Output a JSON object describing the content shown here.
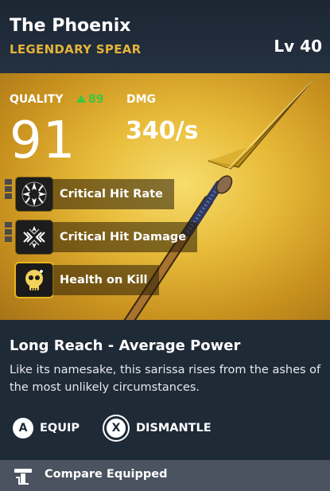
{
  "item": {
    "name": "The Phoenix",
    "type": "LEGENDARY SPEAR",
    "level": "Lv 40"
  },
  "stats": {
    "quality_label": "QUALITY",
    "quality_delta": "89",
    "quality_value": "91",
    "damage_label": "DMG",
    "damage_value": "340/s"
  },
  "perks": [
    {
      "label": "Critical Hit Rate",
      "icon": "crit-rate-icon",
      "tier_bars": 3
    },
    {
      "label": "Critical Hit Damage",
      "icon": "crit-damage-icon",
      "tier_bars": 3
    },
    {
      "label": "Health on Kill",
      "icon": "skull-icon",
      "tier_bars": 0
    }
  ],
  "ability": {
    "title": "Long Reach - Average Power",
    "description": "Like its namesake, this sarissa rises from the ashes of the most unlikely circumstances."
  },
  "actions": {
    "equip": {
      "key": "A",
      "label": "EQUIP"
    },
    "dismantle": {
      "key": "X",
      "label": "DISMANTLE"
    }
  },
  "footer": {
    "compare_label": "Compare Equipped"
  },
  "colors": {
    "accent_gold": "#e3b43a",
    "quality_up": "#3ec63e",
    "panel_bg": "#1f2a37",
    "footer_bg": "#4a535f"
  }
}
